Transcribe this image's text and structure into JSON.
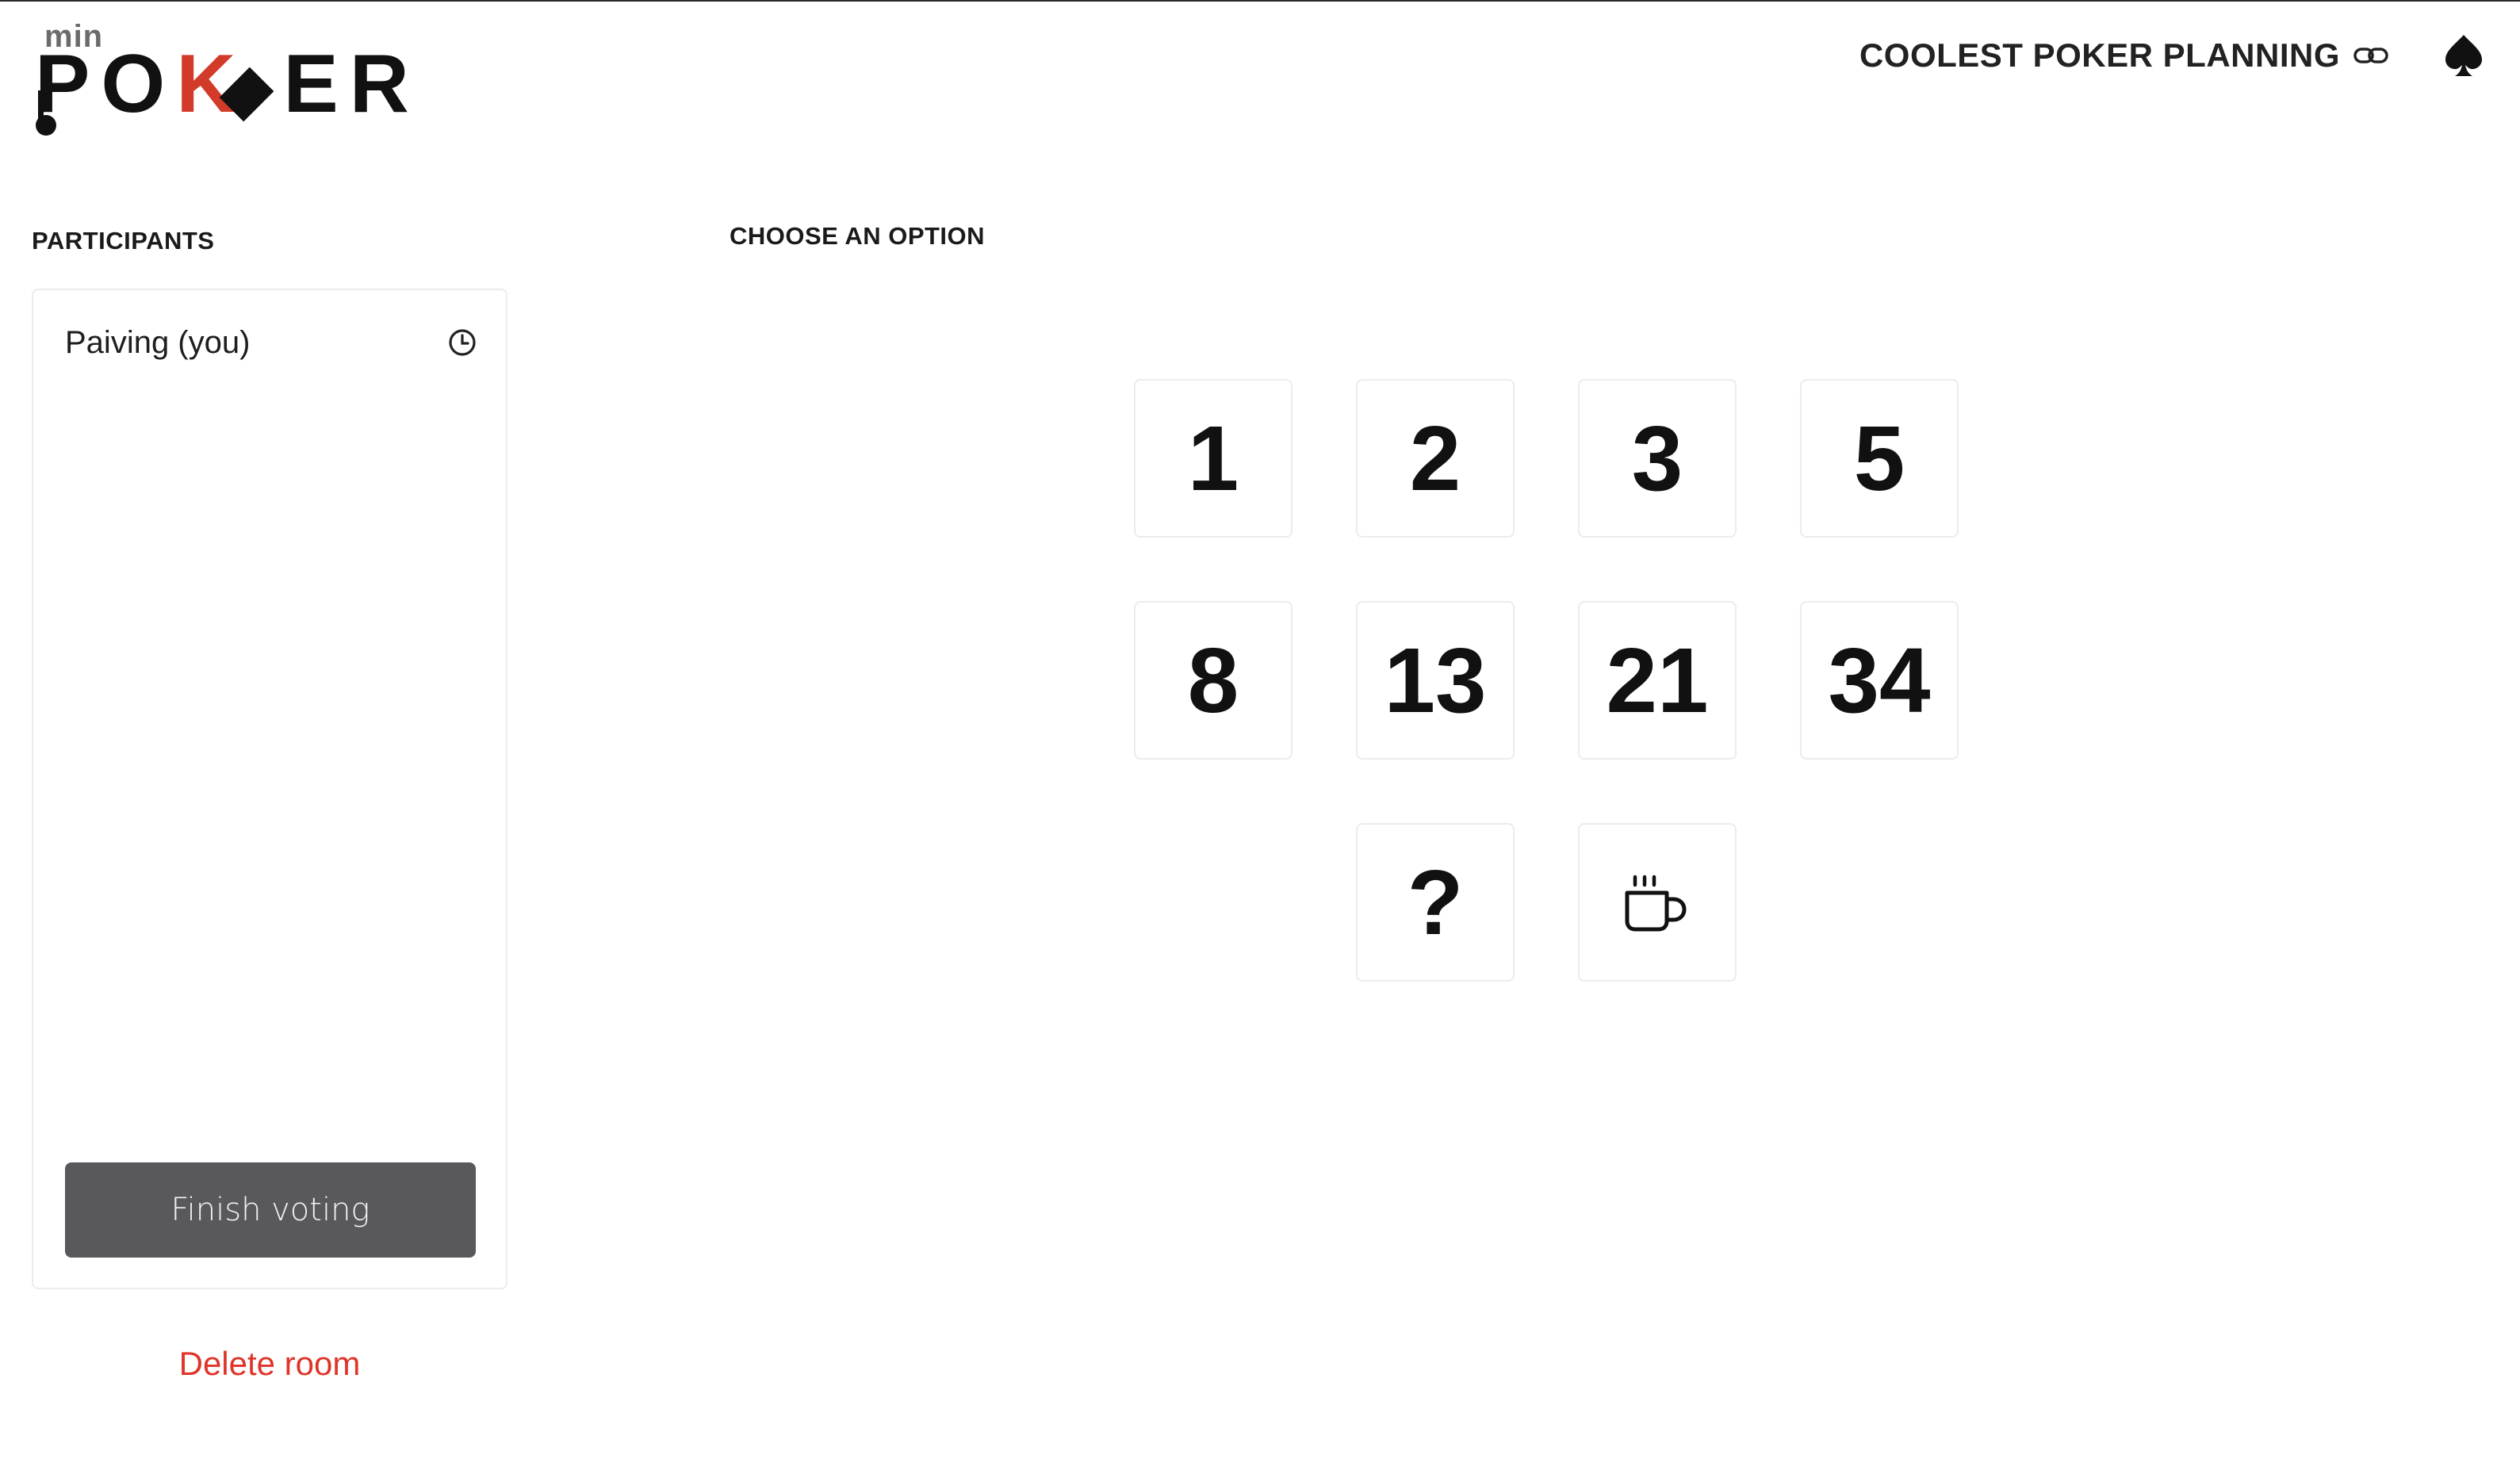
{
  "logo": {
    "prefix": "min",
    "word_part1": "PO",
    "word_k": "K",
    "word_part2": "ER",
    "accent_color": "#d23a2a"
  },
  "header": {
    "room_title": "COOLEST POKER PLANNING",
    "room_link_icon": "link-icon",
    "menu_icon": "spade-icon"
  },
  "participants": {
    "heading": "PARTICIPANTS",
    "list": [
      {
        "name": "Paiving (you)",
        "status_icon": "clock-icon"
      }
    ],
    "finish_button": "Finish voting",
    "delete_link": "Delete room",
    "delete_color": "#e0342a",
    "button_color": "#58585d"
  },
  "options": {
    "heading": "CHOOSE AN OPTION",
    "cards": [
      {
        "label": "1"
      },
      {
        "label": "2"
      },
      {
        "label": "3"
      },
      {
        "label": "5"
      },
      {
        "label": "8"
      },
      {
        "label": "13"
      },
      {
        "label": "21"
      },
      {
        "label": "34"
      },
      {
        "label": "?"
      },
      {
        "label": "",
        "icon": "coffee-icon"
      }
    ]
  }
}
